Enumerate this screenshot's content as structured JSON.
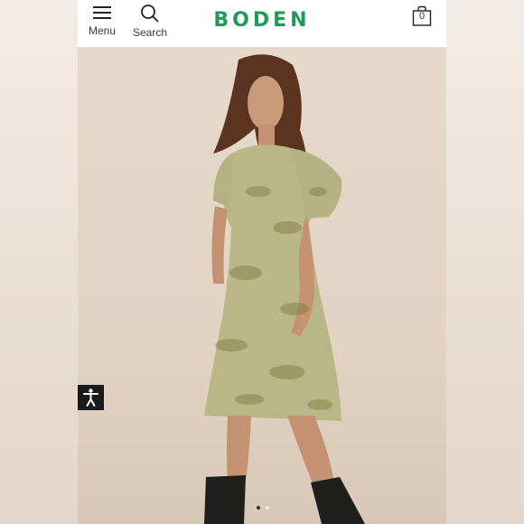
{
  "header": {
    "menu_label": "Menu",
    "search_label": "Search",
    "logo_text": "BODEN",
    "bag_count": "0"
  },
  "hero": {
    "image": "woman wearing a short paisley-print wrap dress with puff sleeves and black knee-high boots"
  },
  "carousel": {
    "total_slides": 2,
    "active_slide": 1
  },
  "colors": {
    "brand": "#1f9a58",
    "background": "#e9ddd0",
    "accessibility_button": "#1a1a1a"
  },
  "icons": [
    "hamburger-menu-icon",
    "search-icon",
    "shopping-bag-icon",
    "accessibility-icon"
  ]
}
